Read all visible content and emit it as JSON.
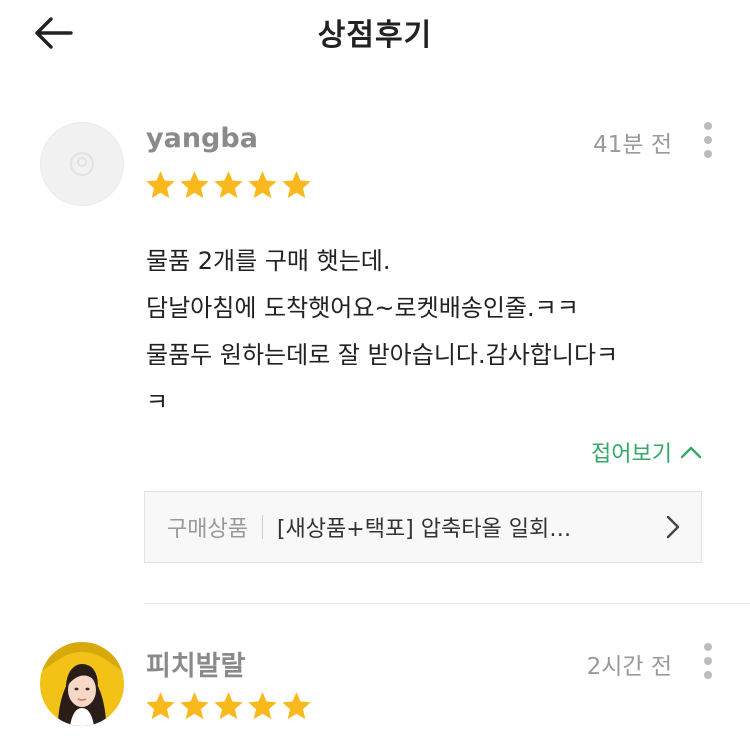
{
  "header": {
    "title": "상점후기",
    "back_icon": "arrow-left-icon"
  },
  "reviews": [
    {
      "username": "yangba",
      "time": "41분 전",
      "rating": 5,
      "body": "물품 2개를 구매 햇는데.\n담날아침에 도착햇어요~로켓배송인줄.ㅋㅋ\n물품두 원하는데로 잘 받아습니다.감사합니다ㅋ\nㅋ",
      "collapse_label": "접어보기",
      "product_label": "구매상품",
      "product_name": "[새상품+택포] 압축타올 일회…"
    },
    {
      "username": "피치발랄",
      "time": "2시간 전",
      "rating": 5
    }
  ],
  "colors": {
    "star": "#f9b81b",
    "accent_green": "#35a86a",
    "username_gray": "#8a8a8a"
  }
}
